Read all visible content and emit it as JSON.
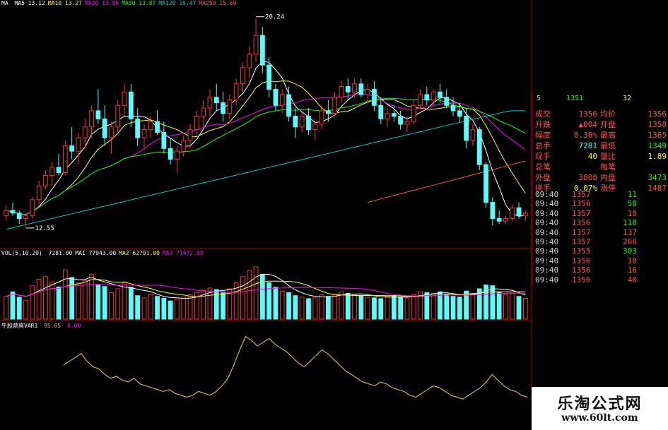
{
  "colors": {
    "ma5": "#ffffff",
    "ma10": "#ffff00",
    "ma20": "#ff00ff",
    "ma30": "#00ff00",
    "ma120": "#00c8c8",
    "ma250": "#ff5050",
    "up": "#ff3232",
    "down": "#54ffff",
    "axis": "#b00000",
    "indicator": "#c8b43c"
  },
  "price_legend": {
    "prefix": "MA",
    "items": [
      {
        "label": "MA5",
        "value": "13.12",
        "color": "#ffffff"
      },
      {
        "label": "MA10",
        "value": "13.27",
        "color": "#ffff00"
      },
      {
        "label": "MA20",
        "value": "13.86",
        "color": "#ff00ff"
      },
      {
        "label": "MA30",
        "value": "13.87",
        "color": "#00ff00"
      },
      {
        "label": "MA120",
        "value": "16.47",
        "color": "#00c8c8"
      },
      {
        "label": "MA250",
        "value": "15.69",
        "color": "#ff5050"
      }
    ]
  },
  "annotations": {
    "high": "20.24",
    "low": "12.55"
  },
  "volume_legend": {
    "title": "VOL(5,10,20)",
    "items": [
      {
        "label": "7281.00",
        "color": "#ffffff"
      },
      {
        "label": "MA1",
        "value": "77943.00",
        "color": "#ffffff"
      },
      {
        "label": "MA2",
        "value": "62791.00",
        "color": "#ffff00"
      },
      {
        "label": "MA3",
        "value": "71572.00",
        "color": "#ff00ff"
      }
    ]
  },
  "indicator_legend": {
    "title": "牛股鼎爽VAR1",
    "v1": "95.05",
    "v2": "0.00"
  },
  "quote_header": {
    "left": "5",
    "mid": "1351",
    "right": "32"
  },
  "quote": [
    {
      "l1": "成交",
      "v1": "1356",
      "l2": "均价",
      "v2": "1356",
      "c1": "#ff5050",
      "c2": "#ff5050"
    },
    {
      "l1": "升跌",
      "v1": "▲004",
      "l2": "开盘",
      "v2": "1358",
      "c1": "#ff5050",
      "c2": "#ff5050"
    },
    {
      "l1": "幅度",
      "v1": "0.30%",
      "l2": "最高",
      "v2": "1365",
      "c1": "#ff5050",
      "c2": "#ff5050"
    },
    {
      "l1": "总手",
      "v1": "7281",
      "l2": "最低",
      "v2": "1349",
      "c1": "#54ffff",
      "c2": "#00ff00"
    },
    {
      "l1": "现手",
      "v1": "40",
      "l2": "量比",
      "v2": "1.89",
      "c1": "#ffff00",
      "c2": "#ffff00"
    },
    {
      "l1": "总笔",
      "v1": "",
      "l2": "每笔",
      "v2": "",
      "c1": "#cccccc",
      "c2": "#cccccc"
    },
    {
      "l1": "外盘",
      "v1": "3808",
      "l2": "内盘",
      "v2": "3473",
      "c1": "#ff5050",
      "c2": "#00ff00"
    },
    {
      "l1": "换手",
      "v1": "0.07%",
      "l2": "涨停",
      "v2": "1487",
      "c1": "#ffff00",
      "c2": "#ff5050"
    }
  ],
  "ticks": [
    {
      "time": "09:40",
      "price": "1357",
      "vol": "11",
      "vc": "#00ff00"
    },
    {
      "time": "09:40",
      "price": "1356",
      "vol": "58",
      "vc": "#00ff00"
    },
    {
      "time": "09:40",
      "price": "1357",
      "vol": "10",
      "vc": "#ff5050"
    },
    {
      "time": "09:40",
      "price": "1356",
      "vol": "110",
      "vc": "#00ff00"
    },
    {
      "time": "09:40",
      "price": "1357",
      "vol": "137",
      "vc": "#ff5050"
    },
    {
      "time": "09:40",
      "price": "1357",
      "vol": "266",
      "vc": "#ff5050"
    },
    {
      "time": "09:40",
      "price": "1355",
      "vol": "303",
      "vc": "#00ff00"
    },
    {
      "time": "09:40",
      "price": "1356",
      "vol": "10",
      "vc": "#ff5050"
    },
    {
      "time": "09:40",
      "price": "1356",
      "vol": "16",
      "vc": "#ff5050"
    },
    {
      "time": "09:40",
      "price": "1356",
      "vol": "40",
      "vc": "#ff5050"
    }
  ],
  "brand": {
    "cn": "乐淘公式网",
    "url": "www.60lt.com"
  },
  "chart_data": [
    {
      "type": "candlestick",
      "title": "",
      "ylim": [
        12,
        20.6
      ],
      "grid": false,
      "ohlc": [
        [
          12.9,
          13.3,
          12.7,
          13.1
        ],
        [
          13.1,
          13.4,
          12.9,
          13.0
        ],
        [
          13.0,
          13.1,
          12.6,
          12.8
        ],
        [
          12.8,
          13.0,
          12.5,
          12.9
        ],
        [
          12.9,
          13.6,
          12.8,
          13.5
        ],
        [
          13.5,
          14.2,
          13.3,
          14.0
        ],
        [
          14.0,
          14.6,
          13.9,
          14.4
        ],
        [
          14.4,
          14.9,
          14.0,
          14.7
        ],
        [
          14.7,
          15.2,
          14.4,
          14.5
        ],
        [
          14.5,
          15.7,
          14.4,
          15.5
        ],
        [
          15.5,
          16.2,
          15.0,
          15.3
        ],
        [
          15.3,
          16.0,
          14.8,
          15.8
        ],
        [
          15.8,
          16.5,
          15.4,
          16.2
        ],
        [
          16.2,
          17.0,
          15.8,
          16.8
        ],
        [
          16.8,
          17.6,
          16.3,
          16.5
        ],
        [
          16.5,
          17.0,
          15.5,
          15.8
        ],
        [
          15.8,
          16.4,
          15.2,
          16.2
        ],
        [
          16.2,
          17.2,
          16.0,
          17.0
        ],
        [
          17.0,
          17.8,
          16.6,
          17.5
        ],
        [
          17.5,
          17.8,
          16.2,
          16.5
        ],
        [
          16.5,
          16.9,
          15.5,
          15.8
        ],
        [
          15.8,
          16.3,
          15.4,
          16.1
        ],
        [
          16.1,
          16.6,
          15.8,
          16.4
        ],
        [
          16.4,
          16.8,
          15.9,
          16.0
        ],
        [
          16.0,
          16.4,
          15.2,
          15.4
        ],
        [
          15.4,
          15.8,
          14.8,
          15.0
        ],
        [
          15.0,
          15.5,
          14.5,
          15.3
        ],
        [
          15.3,
          15.9,
          15.1,
          15.7
        ],
        [
          15.7,
          16.3,
          15.4,
          16.1
        ],
        [
          16.1,
          16.8,
          15.9,
          16.6
        ],
        [
          16.6,
          17.2,
          16.2,
          16.9
        ],
        [
          16.9,
          17.6,
          16.6,
          17.3
        ],
        [
          17.3,
          17.8,
          16.8,
          17.1
        ],
        [
          17.1,
          17.5,
          16.4,
          16.7
        ],
        [
          16.7,
          17.4,
          16.5,
          17.2
        ],
        [
          17.2,
          18.0,
          17.0,
          17.8
        ],
        [
          17.8,
          18.6,
          17.5,
          18.4
        ],
        [
          18.4,
          19.2,
          18.0,
          18.9
        ],
        [
          18.9,
          20.24,
          18.6,
          19.6
        ],
        [
          19.6,
          19.9,
          18.2,
          18.5
        ],
        [
          18.5,
          18.8,
          17.3,
          17.6
        ],
        [
          17.6,
          17.8,
          16.8,
          17.0
        ],
        [
          17.0,
          17.6,
          16.7,
          17.4
        ],
        [
          17.4,
          17.7,
          16.4,
          16.6
        ],
        [
          16.6,
          16.9,
          15.8,
          16.2
        ],
        [
          16.2,
          16.8,
          16.0,
          16.6
        ],
        [
          16.6,
          16.9,
          15.9,
          16.1
        ],
        [
          16.1,
          16.5,
          15.7,
          16.3
        ],
        [
          16.3,
          17.0,
          16.1,
          16.8
        ],
        [
          16.8,
          17.2,
          16.4,
          16.7
        ],
        [
          16.7,
          17.5,
          16.6,
          17.3
        ],
        [
          17.3,
          17.9,
          17.1,
          17.7
        ],
        [
          17.7,
          18.0,
          17.2,
          17.5
        ],
        [
          17.5,
          18.0,
          17.3,
          17.8
        ],
        [
          17.8,
          18.0,
          17.3,
          17.4
        ],
        [
          17.4,
          17.8,
          17.1,
          17.6
        ],
        [
          17.6,
          17.9,
          16.8,
          17.0
        ],
        [
          17.0,
          17.3,
          16.3,
          16.5
        ],
        [
          16.5,
          16.9,
          16.2,
          16.7
        ],
        [
          16.7,
          17.0,
          16.4,
          16.6
        ],
        [
          16.6,
          16.8,
          16.1,
          16.3
        ],
        [
          16.3,
          16.6,
          16.0,
          16.4
        ],
        [
          16.4,
          17.2,
          16.3,
          17.0
        ],
        [
          17.0,
          17.6,
          16.9,
          17.4
        ],
        [
          17.4,
          17.7,
          17.0,
          17.2
        ],
        [
          17.2,
          17.6,
          17.0,
          17.5
        ],
        [
          17.5,
          17.8,
          17.1,
          17.3
        ],
        [
          17.3,
          17.6,
          16.9,
          17.0
        ],
        [
          17.0,
          17.3,
          16.6,
          16.8
        ],
        [
          16.8,
          17.1,
          16.4,
          16.6
        ],
        [
          16.6,
          16.9,
          15.4,
          15.7
        ],
        [
          15.7,
          16.3,
          15.5,
          16.1
        ],
        [
          16.1,
          16.2,
          14.6,
          14.8
        ],
        [
          14.8,
          14.9,
          13.2,
          13.4
        ],
        [
          13.4,
          13.6,
          12.55,
          12.8
        ],
        [
          12.8,
          13.1,
          12.6,
          12.7
        ],
        [
          12.7,
          12.9,
          12.6,
          12.8
        ],
        [
          12.8,
          13.3,
          12.7,
          13.2
        ],
        [
          13.2,
          13.4,
          12.8,
          12.9
        ],
        [
          12.9,
          13.1,
          12.7,
          13.0
        ]
      ],
      "ma_series": [
        {
          "name": "MA5",
          "color": "#ffffff"
        },
        {
          "name": "MA10",
          "color": "#ffff00"
        },
        {
          "name": "MA20",
          "color": "#ff00ff"
        },
        {
          "name": "MA30",
          "color": "#00ff00"
        },
        {
          "name": "MA120",
          "color": "#00c8c8"
        },
        {
          "name": "MA250",
          "color": "#ff5050"
        }
      ]
    },
    {
      "type": "bar",
      "title": "VOL(5,10,20)",
      "ylim": [
        0,
        160000
      ],
      "values": [
        60000,
        72000,
        58000,
        50000,
        88000,
        105000,
        112000,
        98000,
        85000,
        130000,
        110000,
        95000,
        102000,
        118000,
        90000,
        86000,
        70000,
        80000,
        96000,
        84000,
        62000,
        56000,
        66000,
        60000,
        55000,
        48000,
        52000,
        58000,
        64000,
        70000,
        76000,
        82000,
        78000,
        72000,
        80000,
        96000,
        112000,
        128000,
        138000,
        118000,
        96000,
        84000,
        74000,
        70000,
        62000,
        58000,
        54000,
        56000,
        64000,
        60000,
        66000,
        72000,
        68000,
        64000,
        62000,
        58000,
        56000,
        54000,
        60000,
        62000,
        58000,
        56000,
        64000,
        72000,
        70000,
        68000,
        72000,
        66000,
        60000,
        58000,
        74000,
        68000,
        80000,
        90000,
        88000,
        70000,
        64000,
        68000,
        60000,
        55000
      ]
    },
    {
      "type": "line",
      "title": "牛股鼎爽VAR1",
      "ylim": [
        0,
        100
      ],
      "values": [
        62,
        66,
        70,
        74,
        66,
        60,
        58,
        52,
        48,
        50,
        46,
        44,
        48,
        42,
        40,
        38,
        36,
        34,
        36,
        32,
        30,
        28,
        30,
        34,
        32,
        30,
        34,
        40,
        48,
        62,
        78,
        92,
        88,
        82,
        86,
        90,
        84,
        80,
        76,
        70,
        64,
        60,
        66,
        72,
        78,
        74,
        68,
        62,
        56,
        52,
        48,
        44,
        42,
        40,
        44,
        42,
        38,
        36,
        34,
        30,
        28,
        32,
        36,
        40,
        38,
        34,
        30,
        28,
        26,
        30,
        34,
        38,
        44,
        52,
        46,
        40,
        36,
        34,
        30,
        28
      ]
    }
  ]
}
